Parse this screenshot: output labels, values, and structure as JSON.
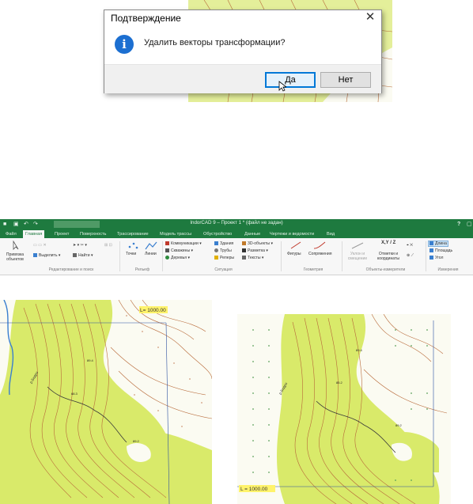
{
  "dialog": {
    "title": "Подтверждение",
    "close_glyph": "✕",
    "icon_glyph": "i",
    "message": "Удалить векторы трансформации?",
    "yes_label": "Да",
    "no_label": "Нет"
  },
  "app": {
    "title": "IndorCAD 9 – Проект 1 * (файл не задан)",
    "help": "?",
    "tabs": [
      "Файл",
      "Главная",
      "Проект",
      "Поверхность",
      "Трассирование",
      "Модель трассы",
      "Обустройство",
      "Данные",
      "Чертежи и ведомости",
      "Вид"
    ],
    "groups": {
      "edit": "Редактирование и поиск",
      "relief": "Рельеф",
      "situation": "Ситуация",
      "geometry": "Геометрия",
      "meas_objects": "Объекты-измерители",
      "measure": "Измерения"
    },
    "commands": {
      "bind_objects": "Привязка объектов",
      "select": "Выделить",
      "find": "Найти",
      "points": "Точки",
      "lines": "Линии",
      "comms": "Коммуникации",
      "wells": "Скважины",
      "trees": "Деревья",
      "buildings": "Здания",
      "pipes": "Трубы",
      "benchmarks": "Реперы",
      "objects3d": "3D-объекты",
      "markup": "Разметка",
      "texts": "Тексты",
      "figures": "Фигуры",
      "mates": "Сопряжения",
      "slope_offset": "Уклон и смещение",
      "marks_coords": "Отметки и координаты",
      "marks_coords_icon": "X,Y / Z",
      "length": "Длина",
      "area": "Площадь",
      "angle": "Угол"
    }
  },
  "maps": {
    "left_label": "L= 1000.00",
    "right_label": "L = 1000.00",
    "spot_labels": [
      "89.4",
      "68.3",
      "89.2",
      "85.2",
      "68.4"
    ],
    "stream_label": "р.Бедро"
  },
  "colors": {
    "ribbon_green": "#1e7a3f",
    "forest": "#d9ea6a",
    "contour": "#b86a3a",
    "accent_blue": "#1c6fd1"
  }
}
